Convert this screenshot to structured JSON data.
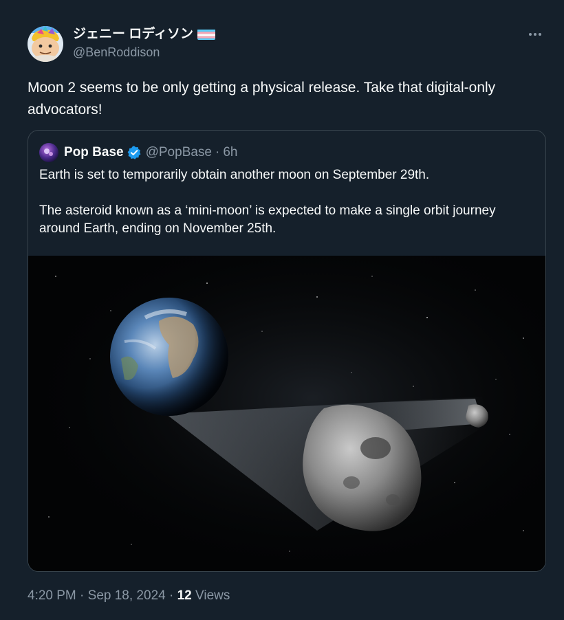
{
  "tweet": {
    "author": {
      "display_name": "ジェニー ロディソン",
      "handle": "@BenRoddison",
      "avatar_icon": "cartoon-avatar-icon",
      "flag_icon": "trans-flag-icon"
    },
    "text": "Moon 2 seems to be only getting a physical release. Take that digital-only advocators!",
    "more_icon": "more-options-icon",
    "quote": {
      "author_name": "Pop Base",
      "verified_icon": "verified-badge-icon",
      "handle": "@PopBase",
      "separator": "·",
      "time_ago": "6h",
      "paragraphs": [
        "Earth is set to temporarily obtain another moon on September 29th.",
        "The asteroid known as a ‘mini-moon’ is expected to make a single orbit journey around Earth, ending on November 25th."
      ],
      "image_alt_icon": "earth-asteroid-image"
    },
    "meta": {
      "time": "4:20 PM",
      "sep1": "·",
      "date": "Sep 18, 2024",
      "sep2": "·",
      "views_count": "12",
      "views_label": "Views"
    },
    "colors": {
      "background": "#15202b",
      "text": "#f7f9f9",
      "secondary": "#8b98a5",
      "border": "#38444d",
      "verified": "#1d9bf0"
    }
  }
}
